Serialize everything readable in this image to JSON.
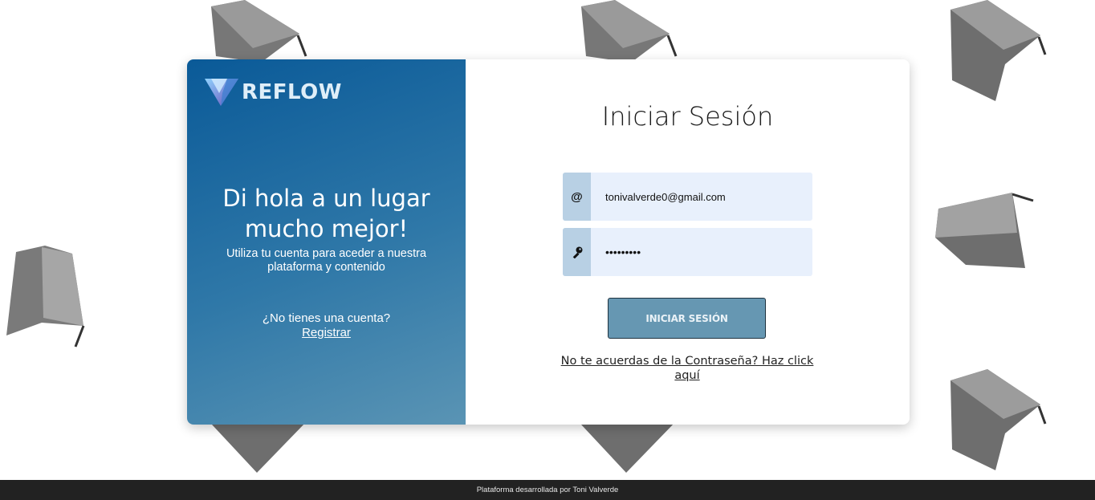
{
  "brand": {
    "name": "REFLOW"
  },
  "hero": {
    "title": "Di hola a un lugar mucho mejor!",
    "subtitle": "Utiliza tu cuenta para aceder a nuestra plataforma y contenido"
  },
  "signup": {
    "prompt": "¿No tienes una cuenta?",
    "link_label": "Registrar"
  },
  "login": {
    "title": "Iniciar Sesión",
    "email_icon": "@",
    "email_value": "tonivalverde0@gmail.com",
    "password_value": "•••••••••",
    "submit_label": "INICIAR SESIÓN",
    "forgot_label": "No te acuerdas de la Contraseña? Haz click aquí"
  },
  "footer": {
    "text": "Plataforma desarrollada por Toni Valverde"
  },
  "colors": {
    "panel_gradient_start": "#0a5a98",
    "panel_gradient_end": "#5a94b4",
    "input_bg": "#e8f0fc",
    "icon_bg": "#b8d0e4",
    "button_bg": "#6697b2",
    "footer_bg": "#222222"
  },
  "icons": {
    "email": "at-sign-icon",
    "password": "key-icon",
    "logo": "reflow-logo-icon",
    "background": "graduation-cap-icon"
  }
}
